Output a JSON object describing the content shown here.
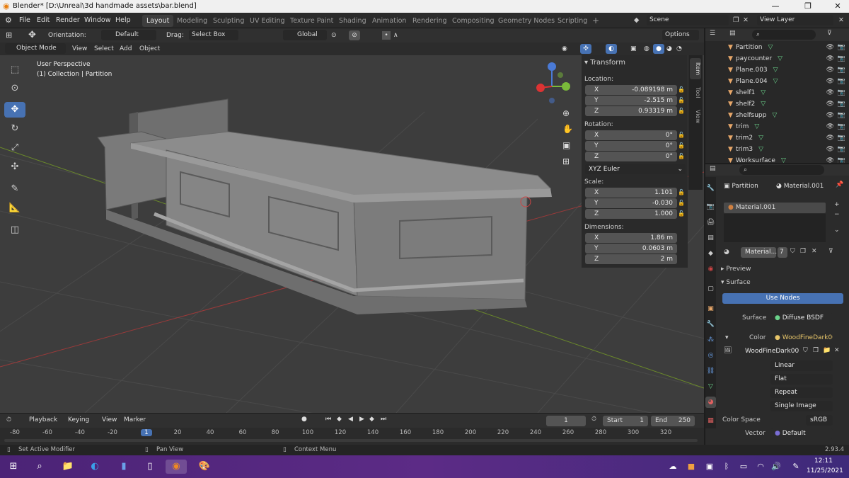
{
  "window": {
    "title": "Blender* [D:\\Unreal\\3d handmade assets\\bar.blend]",
    "minimize": "—",
    "maximize": "❐",
    "close": "✕"
  },
  "menu": {
    "items": [
      "File",
      "Edit",
      "Render",
      "Window",
      "Help"
    ]
  },
  "workspaces": [
    "Layout",
    "Modeling",
    "Sculpting",
    "UV Editing",
    "Texture Paint",
    "Shading",
    "Animation",
    "Rendering",
    "Compositing",
    "Geometry Nodes",
    "Scripting"
  ],
  "workspace_add": "+",
  "scene": {
    "label": "Scene",
    "view_layer": "View Layer"
  },
  "header3d": {
    "orientation_label": "Orientation:",
    "orientation_value": "Default",
    "drag_label": "Drag:",
    "drag_value": "Select Box",
    "transform_orientation": "Global",
    "options": "Options"
  },
  "subheader": {
    "mode": "Object Mode",
    "items": [
      "View",
      "Select",
      "Add",
      "Object"
    ]
  },
  "viewport": {
    "perspective": "User Perspective",
    "collection": "(1) Collection | Partition"
  },
  "npanel": {
    "tabs": [
      "Item",
      "Tool",
      "View"
    ],
    "section": "Transform",
    "location_label": "Location:",
    "location": [
      {
        "axis": "X",
        "value": "-0.089198 m"
      },
      {
        "axis": "Y",
        "value": "-2.515 m"
      },
      {
        "axis": "Z",
        "value": "0.93319 m"
      }
    ],
    "rotation_label": "Rotation:",
    "rotation": [
      {
        "axis": "X",
        "value": "0°"
      },
      {
        "axis": "Y",
        "value": "0°"
      },
      {
        "axis": "Z",
        "value": "0°"
      }
    ],
    "rotation_mode": "XYZ Euler",
    "scale_label": "Scale:",
    "scale": [
      {
        "axis": "X",
        "value": "1.101"
      },
      {
        "axis": "Y",
        "value": "-0.030"
      },
      {
        "axis": "Z",
        "value": "1.000"
      }
    ],
    "dimensions_label": "Dimensions:",
    "dimensions": [
      {
        "axis": "X",
        "value": "1.86 m"
      },
      {
        "axis": "Y",
        "value": "0.0603 m"
      },
      {
        "axis": "Z",
        "value": "2 m"
      }
    ]
  },
  "outliner": {
    "items": [
      "Partition",
      "paycounter",
      "Plane.003",
      "Plane.004",
      "shelf1",
      "shelf2",
      "shelfsupp",
      "trim",
      "trim2",
      "trim3",
      "Worksurface"
    ]
  },
  "properties": {
    "object": "Partition",
    "material_slot": "Material.001",
    "material_list_item": "Material.001",
    "material_name": "Material...",
    "users": "7",
    "preview": "Preview",
    "surface_section": "Surface",
    "use_nodes": "Use Nodes",
    "surface_label": "Surface",
    "surface_value": "Diffuse BSDF",
    "color_label": "Color",
    "color_value": "WoodFineDark00...",
    "image_name": "WoodFineDark00...",
    "interp": "Linear",
    "projection": "Flat",
    "extension": "Repeat",
    "source": "Single Image",
    "color_space_label": "Color Space",
    "color_space_value": "sRGB",
    "vector_label": "Vector",
    "vector_value": "Default"
  },
  "timeline": {
    "menu": [
      "Playback",
      "Keying",
      "View",
      "Marker"
    ],
    "current_frame": "1",
    "start_label": "Start",
    "start": "1",
    "end_label": "End",
    "end": "250",
    "ticks": [
      "-80",
      "-60",
      "-40",
      "-20",
      "1",
      "20",
      "40",
      "60",
      "80",
      "100",
      "120",
      "140",
      "160",
      "180",
      "200",
      "220",
      "240",
      "260",
      "280",
      "300",
      "320"
    ]
  },
  "status": {
    "left": "Set Active Modifier",
    "middle": "Pan View",
    "right": "Context Menu",
    "version": "2.93.4"
  },
  "taskbar": {
    "time": "12:11",
    "date": "11/25/2021"
  },
  "colors": {
    "accent": "#4772b3",
    "bg": "#3d3d3d",
    "object_orange": "#e8a86a",
    "mesh_green": "#6bd38b"
  }
}
